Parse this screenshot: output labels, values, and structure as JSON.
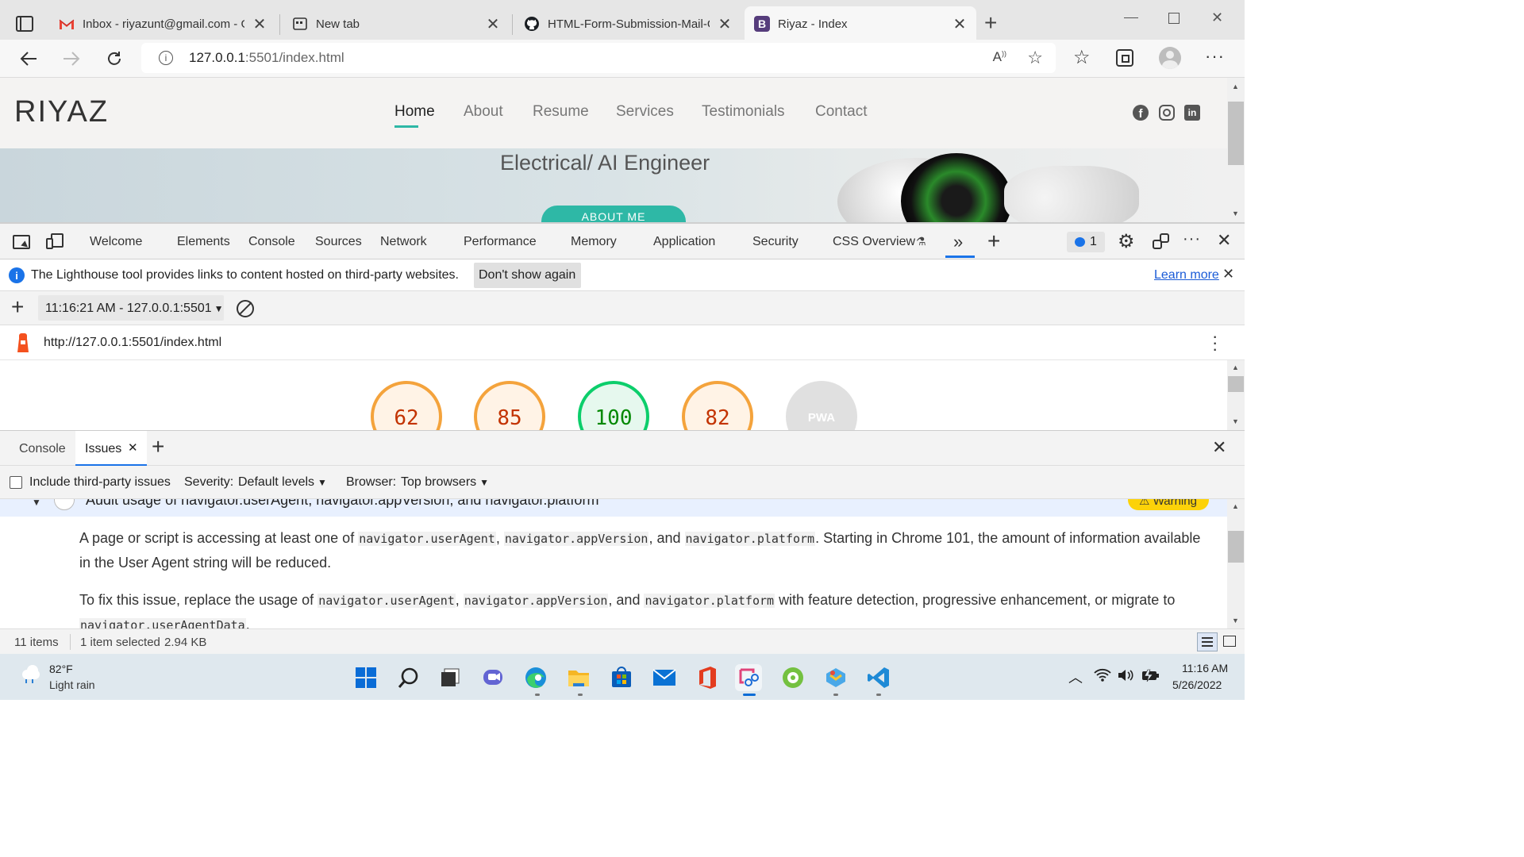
{
  "browser": {
    "tabs": [
      {
        "title": "Inbox - riyazunt@gmail.com - Gr",
        "icon": "gmail-icon"
      },
      {
        "title": "New tab",
        "icon": "newtab-icon"
      },
      {
        "title": "HTML-Form-Submission-Mail-Go",
        "icon": "github-icon"
      },
      {
        "title": "Riyaz - Index",
        "icon": "bootstrap-icon"
      }
    ],
    "url_host": "127.0.0.1",
    "url_rest": ":5501/index.html"
  },
  "site": {
    "logo": "RIYAZ",
    "nav": [
      "Home",
      "About",
      "Resume",
      "Services",
      "Testimonials",
      "Contact"
    ],
    "hero_title": "Electrical/ AI Engineer",
    "hero_button": "ABOUT ME"
  },
  "devtools": {
    "tabs": [
      "Welcome",
      "Elements",
      "Console",
      "Sources",
      "Network",
      "Performance",
      "Memory",
      "Application",
      "Security",
      "CSS Overview"
    ],
    "issue_count": "1",
    "infobar_text": "The Lighthouse tool provides links to content hosted on third-party websites.",
    "dont_show": "Don't show again",
    "learn_more": "Learn more",
    "report_select": "11:16:21 AM - 127.0.0.1:5501",
    "report_url": "http://127.0.0.1:5501/index.html",
    "scores": [
      {
        "value": "62",
        "color": "#f4a33c",
        "text": "#c33300"
      },
      {
        "value": "85",
        "color": "#f4a33c",
        "text": "#c33300"
      },
      {
        "value": "100",
        "color": "#0cce6b",
        "text": "#008800"
      },
      {
        "value": "82",
        "color": "#f4a33c",
        "text": "#c33300"
      },
      {
        "value": "PWA",
        "color": "#e0e0e0",
        "text": "#ffffff"
      }
    ],
    "drawer_tabs": [
      "Console",
      "Issues"
    ],
    "include_third_party": "Include third-party issues",
    "severity_label": "Severity:",
    "severity_value": "Default levels",
    "browser_label": "Browser:",
    "browser_value": "Top browsers",
    "issue_title": "Audit usage of navigator.userAgent, navigator.appVersion, and navigator.platform",
    "warning_badge": "Warning",
    "p1_a": "A page or script is accessing at least one of",
    "p1_code1": "navigator.userAgent",
    "p1_code2": "navigator.appVersion",
    "p1_and": ", and",
    "p1_code3": "navigator.platform",
    "p1_b": ". Starting in Chrome 101, the amount of information available in the User Agent string will be reduced.",
    "p2_a": "To fix this issue, replace the usage of",
    "p2_b": "with feature detection, progressive enhancement, or migrate to",
    "p2_code4": "navigator.userAgentData",
    "status_items": "11 items",
    "status_selected": "1 item selected",
    "status_size": "2.94 KB"
  },
  "taskbar": {
    "temp": "82°F",
    "weather": "Light rain",
    "time": "11:16 AM",
    "date": "5/26/2022"
  }
}
